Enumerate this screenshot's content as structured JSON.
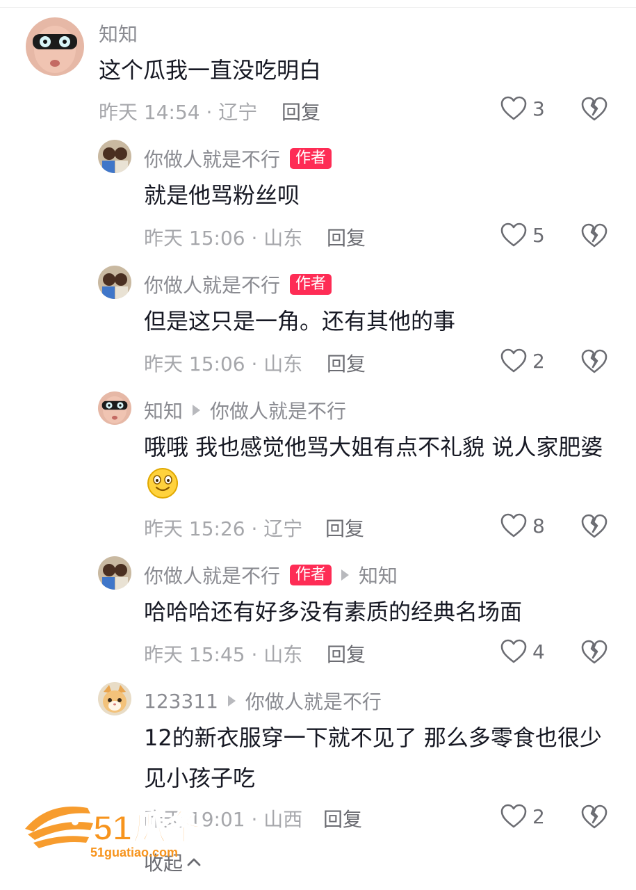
{
  "comments": [
    {
      "user": "知知",
      "author_tag": "",
      "reply_to": "",
      "text": "这个瓜我一直没吃明白",
      "time_loc": "昨天 14:54 · 辽宁",
      "reply_label": "回复",
      "likes": "3"
    },
    {
      "user": "你做人就是不行",
      "author_tag": "作者",
      "reply_to": "",
      "text": "就是他骂粉丝呗",
      "time_loc": "昨天 15:06 · 山东",
      "reply_label": "回复",
      "likes": "5"
    },
    {
      "user": "你做人就是不行",
      "author_tag": "作者",
      "reply_to": "",
      "text": "但是这只是一角。还有其他的事",
      "time_loc": "昨天 15:06 · 山东",
      "reply_label": "回复",
      "likes": "2"
    },
    {
      "user": "知知",
      "author_tag": "",
      "reply_to": "你做人就是不行",
      "text": "哦哦 我也感觉他骂大姐有点不礼貌 说人家肥婆",
      "time_loc": "昨天 15:26 · 辽宁",
      "reply_label": "回复",
      "likes": "8"
    },
    {
      "user": "你做人就是不行",
      "author_tag": "作者",
      "reply_to": "知知",
      "text": "哈哈哈还有好多没有素质的经典名场面",
      "time_loc": "昨天 15:45 · 山东",
      "reply_label": "回复",
      "likes": "4"
    },
    {
      "user": "123311",
      "author_tag": "",
      "reply_to": "你做人就是不行",
      "text": "12的新衣服穿一下就不见了 那么多零食也很少见小孩子吃",
      "time_loc": "昨天 19:01 · 山西",
      "reply_label": "回复",
      "likes": "2"
    }
  ],
  "collapse_label": "收起",
  "watermark": {
    "brand": "51瓜条",
    "url": "51guatiao.com"
  },
  "colors": {
    "author_tag_bg": "#fe2c55",
    "watermark": "#f7941d"
  }
}
